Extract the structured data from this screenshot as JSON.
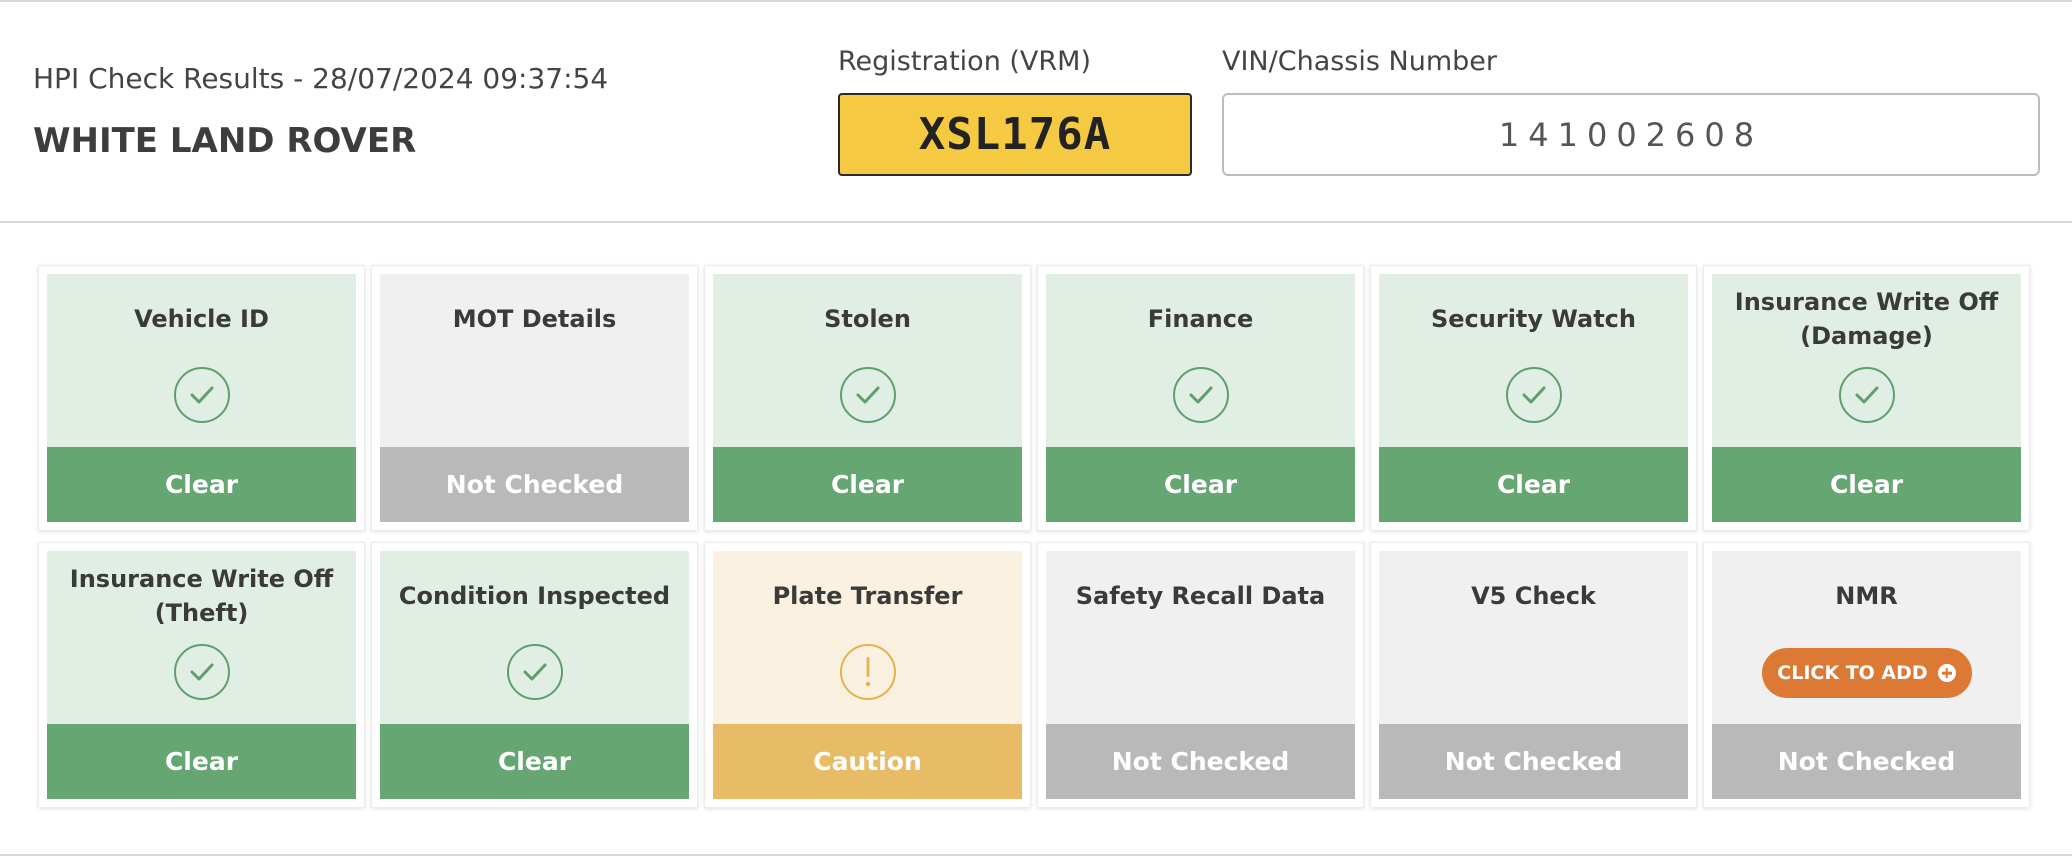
{
  "header": {
    "check_title": "HPI Check Results - 28/07/2024 09:37:54",
    "vehicle_name": "WHITE LAND ROVER",
    "registration_label": "Registration (VRM)",
    "registration_value": "XSL176A",
    "vin_label": "VIN/Chassis Number",
    "vin_value": "141002608"
  },
  "status_colors": {
    "clear": "#66a673",
    "not_checked": "#b9b9b9",
    "caution": "#e8bc66",
    "add_button": "#dc7a35",
    "plate_yellow": "#f6c942"
  },
  "checks": [
    {
      "title": "Vehicle ID",
      "status": "Clear",
      "icon": "check-icon"
    },
    {
      "title": "MOT Details",
      "status": "Not Checked",
      "icon": ""
    },
    {
      "title": "Stolen",
      "status": "Clear",
      "icon": "check-icon"
    },
    {
      "title": "Finance",
      "status": "Clear",
      "icon": "check-icon"
    },
    {
      "title": "Security Watch",
      "status": "Clear",
      "icon": "check-icon"
    },
    {
      "title": "Insurance Write Off (Damage)",
      "status": "Clear",
      "icon": "check-icon"
    },
    {
      "title": "Insurance Write Off (Theft)",
      "status": "Clear",
      "icon": "check-icon"
    },
    {
      "title": "Condition Inspected",
      "status": "Clear",
      "icon": "check-icon"
    },
    {
      "title": "Plate Transfer",
      "status": "Caution",
      "icon": "exclamation-icon"
    },
    {
      "title": "Safety Recall Data",
      "status": "Not Checked",
      "icon": ""
    },
    {
      "title": "V5 Check",
      "status": "Not Checked",
      "icon": ""
    },
    {
      "title": "NMR",
      "status": "Not Checked",
      "icon": "",
      "action_label": "CLICK TO ADD",
      "action_icon": "plus-circle-icon"
    }
  ]
}
